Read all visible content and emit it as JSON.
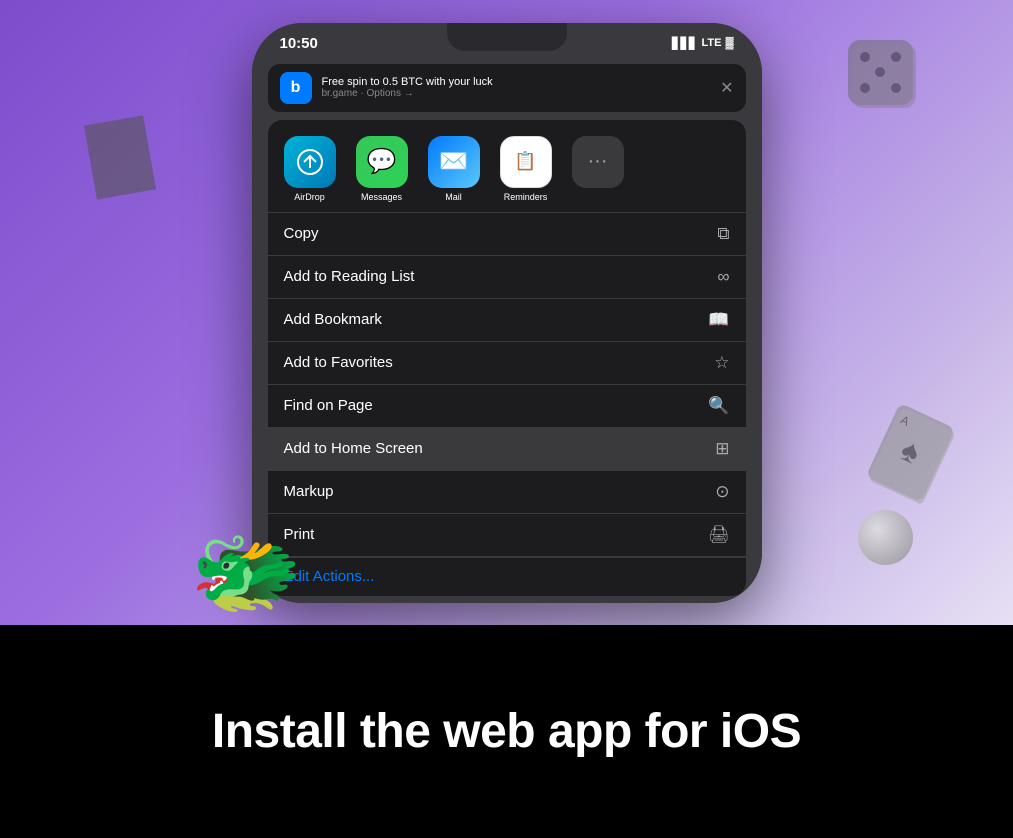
{
  "top": {
    "background_gradient": "linear-gradient(135deg, #7c4dcc 0%, #9b6ee0 40%, #c8b8e8 80%, #e8e0f5 100%)"
  },
  "phone": {
    "time": "10:50",
    "signal": "▋▋▋",
    "lte": "LTE",
    "battery": "🔋"
  },
  "notification": {
    "icon": "b",
    "title": "Free spin to 0.5 BTC with your luck",
    "subtitle": "br.game · Options →"
  },
  "apps": [
    {
      "label": "AirDrop",
      "type": "airdrop"
    },
    {
      "label": "Messages",
      "type": "messages"
    },
    {
      "label": "Mail",
      "type": "mail"
    },
    {
      "label": "Reminders",
      "type": "reminders"
    },
    {
      "label": "",
      "type": "more"
    }
  ],
  "menu_items": [
    {
      "label": "Copy",
      "icon": "⧉",
      "highlighted": false
    },
    {
      "label": "Add to Reading List",
      "icon": "∞",
      "highlighted": false
    },
    {
      "label": "Add Bookmark",
      "icon": "📖",
      "highlighted": false
    },
    {
      "label": "Add to Favorites",
      "icon": "☆",
      "highlighted": false
    },
    {
      "label": "Find on Page",
      "icon": "🔍",
      "highlighted": false
    },
    {
      "label": "Add to Home Screen",
      "icon": "⊞",
      "highlighted": true
    },
    {
      "label": "Markup",
      "icon": "⊙",
      "highlighted": false
    },
    {
      "label": "Print",
      "icon": "🖨",
      "highlighted": false
    }
  ],
  "edit_actions": "Edit Actions...",
  "bottom": {
    "title": "Install the web app for iOS"
  }
}
